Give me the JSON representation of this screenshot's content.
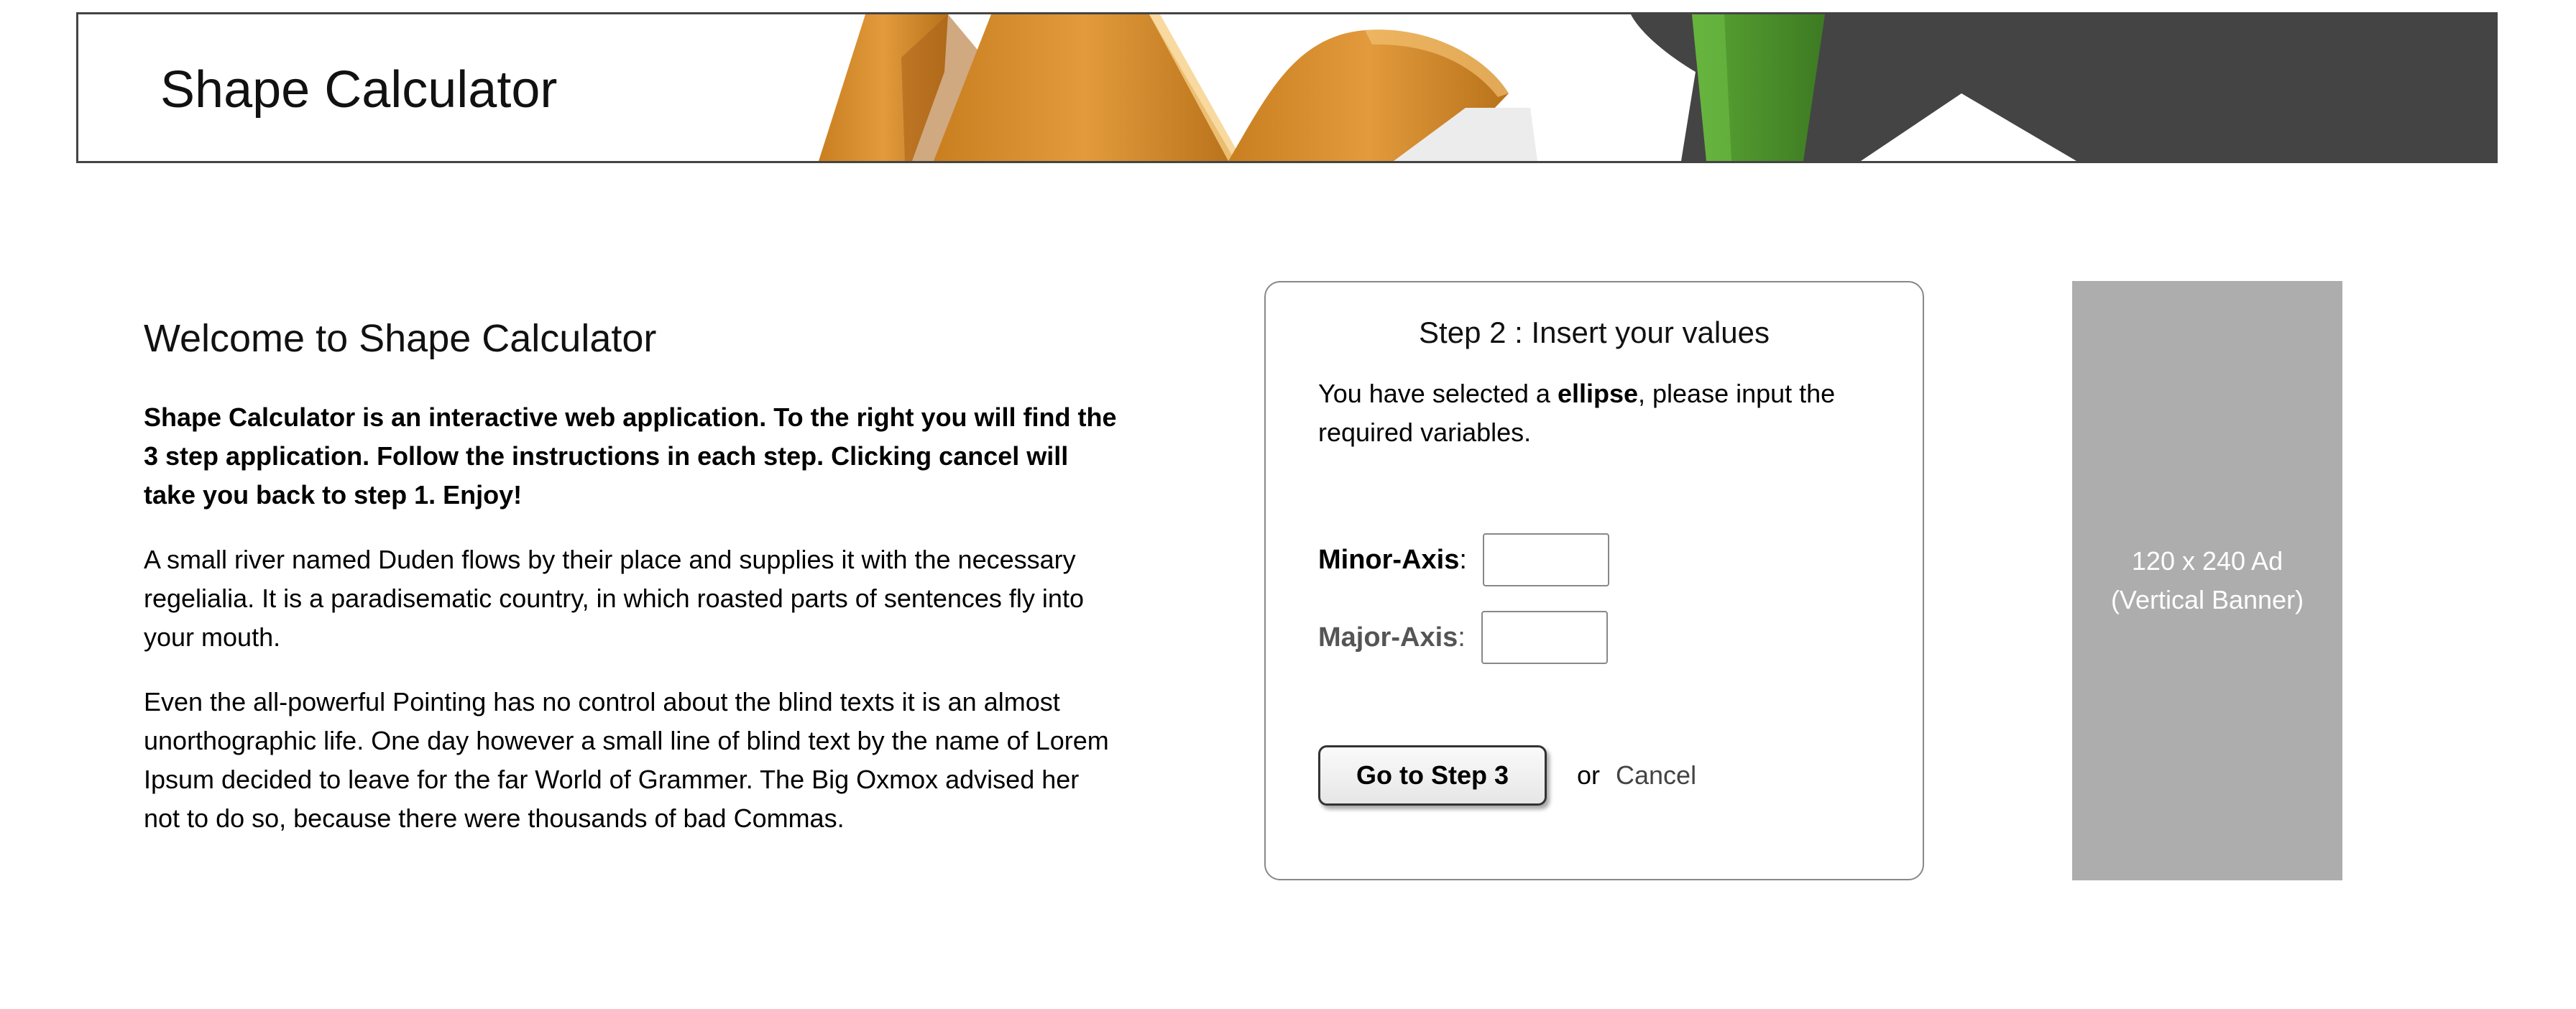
{
  "header": {
    "title": "Shape Calculator"
  },
  "intro": {
    "heading": "Welcome to Shape Calculator",
    "lead": "Shape Calculator is an interactive web application. To the right you will find the 3 step application. Follow the instructions in each step. Clicking cancel will take you back to step 1. Enjoy!",
    "paragraph1": "A small river named Duden flows by their place and supplies it with the necessary regelialia. It is a paradisematic country, in which roasted parts of sentences fly into your mouth.",
    "paragraph2": "Even the all-powerful Pointing has no control about the blind texts it is an almost unorthographic life. One day however a small line of blind text by the name of Lorem Ipsum decided to leave for the far World of Grammer. The Big Oxmox advised her not to do so, because there were thousands of bad Commas."
  },
  "step": {
    "title": "Step 2 : Insert your values",
    "desc_prefix": "You have selected a ",
    "shape": "ellipse",
    "desc_suffix": ", please input the required variables.",
    "fields": [
      {
        "label": "Minor-Axis",
        "value": ""
      },
      {
        "label": "Major-Axis",
        "value": ""
      }
    ],
    "colon": ":",
    "next_label": "Go to Step 3",
    "or_text": "or",
    "cancel_label": "Cancel"
  },
  "ad": {
    "line1": "120 x 240 Ad",
    "line2": "(Vertical Banner)"
  },
  "colors": {
    "orange": "#d68a2e",
    "green": "#4f9a2e",
    "dark": "#444444",
    "ad_bg": "#adadad"
  }
}
